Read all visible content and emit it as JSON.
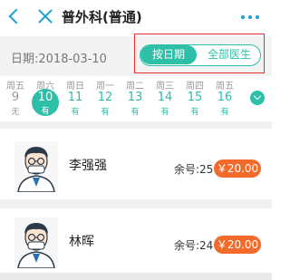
{
  "header": {
    "title": "普外科(普通)",
    "back_icon": "back-chevron-icon",
    "close_icon": "close-icon",
    "more_icon": "more-dots-icon",
    "accent": "#1a9fd6"
  },
  "date_bar": {
    "date_label": "日期:2018-03-10",
    "toggle": {
      "by_date": "按日期",
      "all_doctors": "全部医生",
      "active": "按日期"
    },
    "highlight_color": "#e03030"
  },
  "week": [
    {
      "weekday": "周五",
      "day": "9",
      "status": "无"
    },
    {
      "weekday": "周六",
      "day": "10",
      "status": "有",
      "selected": true
    },
    {
      "weekday": "周日",
      "day": "11",
      "status": "有"
    },
    {
      "weekday": "周一",
      "day": "12",
      "status": "有"
    },
    {
      "weekday": "周二",
      "day": "13",
      "status": "有"
    },
    {
      "weekday": "周三",
      "day": "14",
      "status": "有"
    },
    {
      "weekday": "周四",
      "day": "15",
      "status": "有"
    },
    {
      "weekday": "周五",
      "day": "16",
      "status": "有"
    }
  ],
  "doctors": [
    {
      "name": "李强强",
      "remaining": "余号:25",
      "price": "￥20.00"
    },
    {
      "name": "林晖",
      "remaining": "余号:24",
      "price": "￥20.00"
    }
  ],
  "colors": {
    "teal": "#2dbfa8",
    "price": "#f36b2a"
  }
}
